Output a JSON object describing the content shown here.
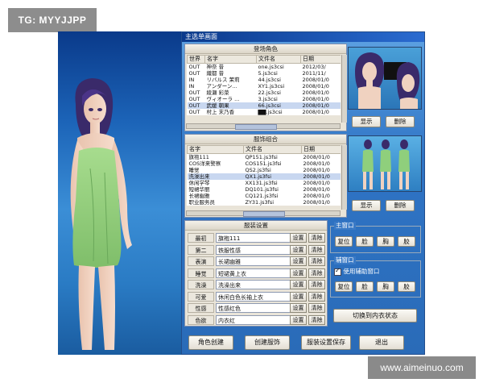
{
  "watermarks": {
    "top": "TG: MYYJJPP",
    "bottom": "www.aimeinuo.com"
  },
  "window": {
    "title": "主选单画面"
  },
  "characters_panel": {
    "title": "登场角色",
    "columns": [
      "世界",
      "名字",
      "文件名",
      "日期"
    ],
    "rows": [
      [
        "OUT",
        "神奈 昔",
        "one.js3csi",
        "2012/03/"
      ],
      [
        "OUT",
        "織都 昔",
        "5.js3csi",
        "2011/11/"
      ],
      [
        "IN",
        "リバルス 茉莉",
        "44.js3csi",
        "2008/01/0"
      ],
      [
        "IN",
        "アンダーン...",
        "XY1.js3csi",
        "2008/01/0"
      ],
      [
        "OUT",
        "綾瀬 彩菜",
        "22.js3csi",
        "2008/01/0"
      ],
      [
        "OUT",
        "ヴィオーラ ...",
        "3.js3csi",
        "2008/01/0"
      ],
      [
        "OUT",
        "武媛 朝果",
        "66.js3csi",
        "2008/01/0"
      ],
      [
        "OUT",
        "村上 末乃香",
        "▇▇.js3csi",
        "2008/01/0"
      ]
    ],
    "selected_row": 6
  },
  "outfit_panel": {
    "title": "服饰组合",
    "columns": [
      "名字",
      "文件名",
      "日期"
    ],
    "rows": [
      [
        "旗袍111",
        "QP151.js3fsi",
        "2008/01/0"
      ],
      [
        "COS洋来警察",
        "COS151.js3fsi",
        "2008/01/0"
      ],
      [
        "睡觉",
        "QS2.js3fsi",
        "2008/01/0"
      ],
      [
        "洗澡出来",
        "QX1.js3fsi",
        "2008/01/0"
      ],
      [
        "休闲学琴",
        "XX131.js3fsi",
        "2008/01/0"
      ],
      [
        "短裙华丽",
        "DQ101.js3fsi",
        "2008/01/0"
      ],
      [
        "长裙幽雅",
        "CQ121.js3fsi",
        "2008/01/0"
      ],
      [
        "职业服务员",
        "ZY31.js3fsi",
        "2008/01/0"
      ]
    ],
    "selected_row": 3
  },
  "costume_settings": {
    "title": "服装设置",
    "set_label": "设置",
    "clear_label": "清除",
    "rows": [
      {
        "label": "最初",
        "value": "旗袍111"
      },
      {
        "label": "第二",
        "value": "铁服性感"
      },
      {
        "label": "表演",
        "value": "长裙幽雅"
      },
      {
        "label": "睡觉",
        "value": "短裙黄上衣"
      },
      {
        "label": "洗澡",
        "value": "洗澡出来"
      },
      {
        "label": "可爱",
        "value": "休闲白色长袖上衣"
      },
      {
        "label": "性感",
        "value": "性感红色"
      },
      {
        "label": "色欲",
        "value": "内衣红"
      }
    ]
  },
  "preview": {
    "show_label": "显示",
    "delete_label": "删除"
  },
  "main_window": {
    "title": "主窗口",
    "buttons": [
      "复位",
      "脸",
      "胸",
      "胶"
    ]
  },
  "aux_window": {
    "title": "辅窗口",
    "checkbox_label": "使用辅助窗口",
    "checked": true,
    "buttons": [
      "复位",
      "脸",
      "胸",
      "胶"
    ]
  },
  "switch_button": "切换到内衣状态",
  "bottom_buttons": [
    "角色创建",
    "创建服饰",
    "服装设置保存",
    "退出"
  ],
  "colors": {
    "window_blue": "#2f74c5",
    "title_blue": "#0b3a8c",
    "panel_bg": "#e9e4d8",
    "dress_green": "#8fcf7c"
  }
}
